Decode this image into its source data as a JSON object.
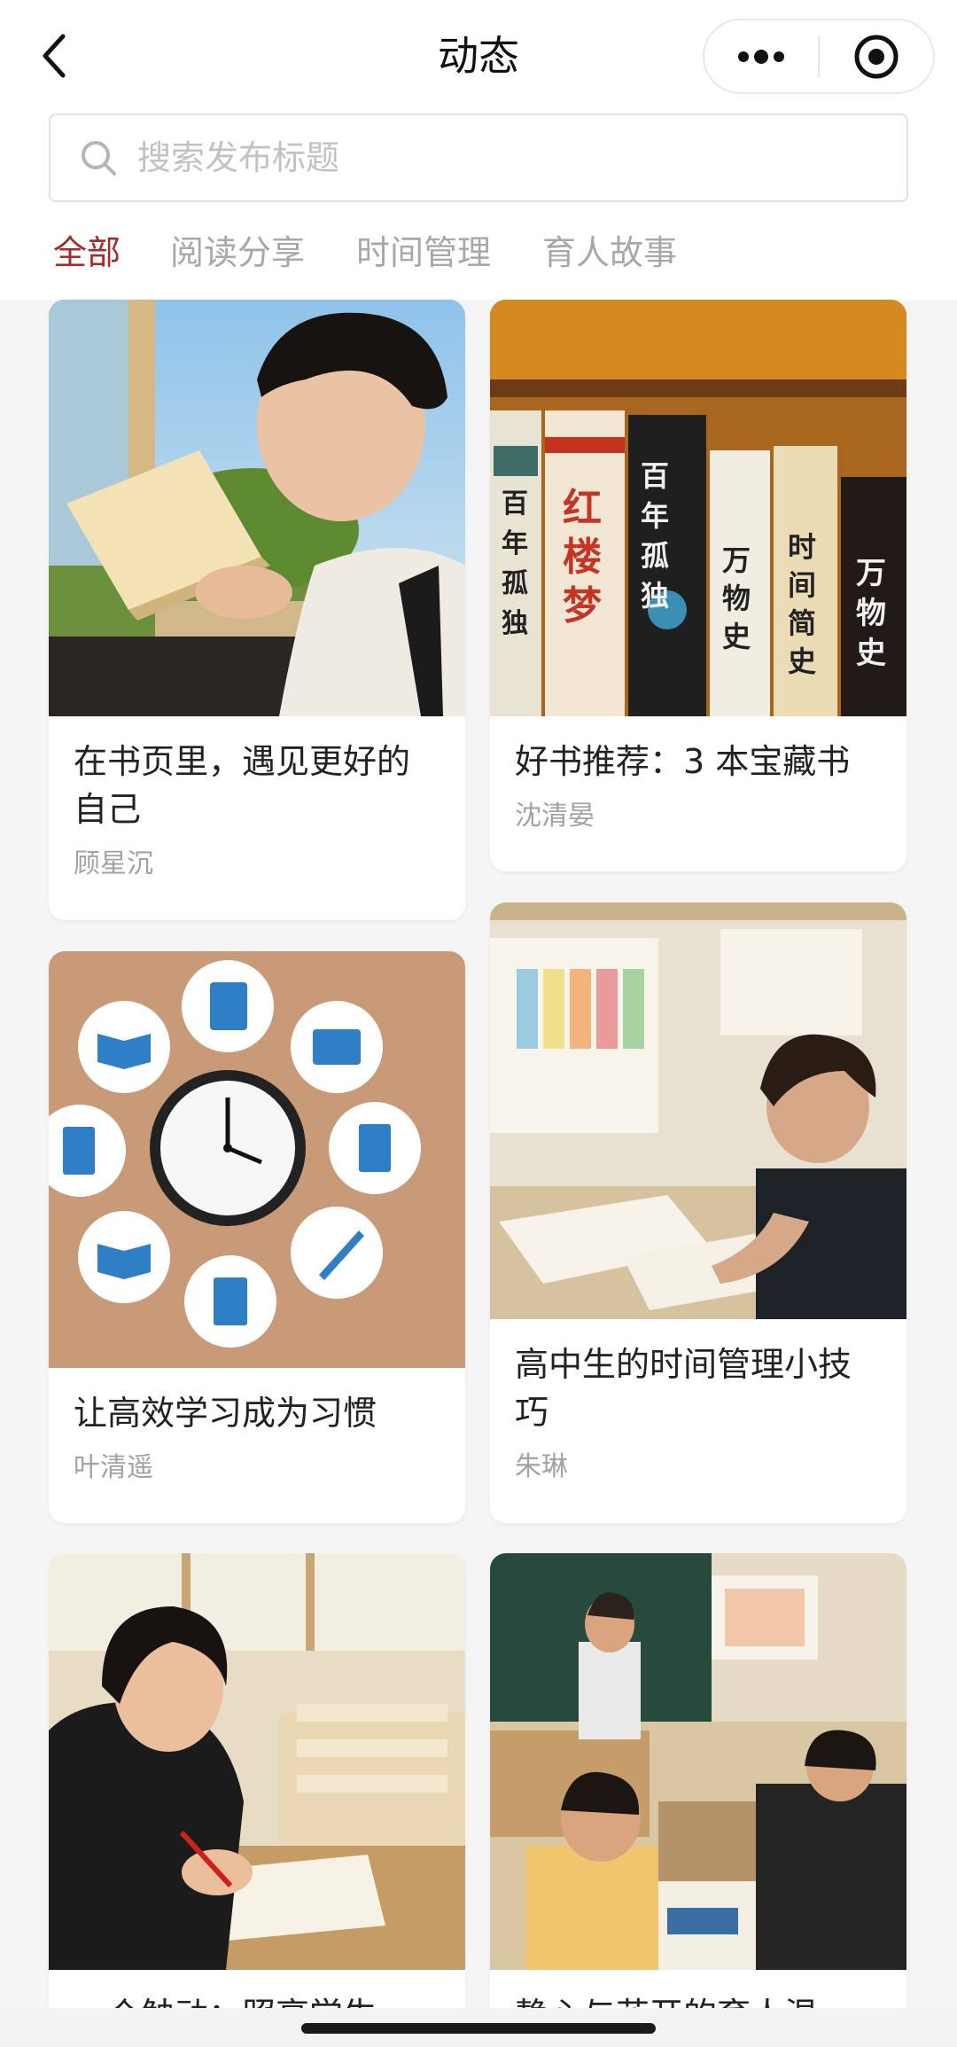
{
  "header": {
    "title": "动态",
    "back_icon": "chevron-left-icon",
    "more_icon": "more-dots-icon",
    "target_icon": "target-icon"
  },
  "search": {
    "placeholder": "搜索发布标题",
    "value": "",
    "icon": "search-icon"
  },
  "tabs": [
    {
      "label": "全部",
      "active": true
    },
    {
      "label": "阅读分享",
      "active": false
    },
    {
      "label": "时间管理",
      "active": false
    },
    {
      "label": "育人故事",
      "active": false
    }
  ],
  "colors": {
    "accent": "#a42a2a",
    "tab_inactive": "#a8a8a8",
    "author": "#a2a2a2"
  },
  "cards": [
    {
      "title": "在书页里，遇见更好的自己",
      "author": "顾星沉",
      "image": "student-reading-photo"
    },
    {
      "title": "好书推荐：3 本宝藏书",
      "author": "沈清晏",
      "image": "bookshelf-photo",
      "book_spines": [
        "百年孤独",
        "红楼梦",
        "百年孤独",
        "万物史",
        "时间简史",
        "万物史"
      ]
    },
    {
      "title": "让高效学习成为习惯",
      "author": "叶清遥",
      "image": "clock-and-study-icons-photo"
    },
    {
      "title": "高中生的时间管理小技巧",
      "author": "朱琳",
      "image": "student-studying-desk-photo"
    },
    {
      "title": "一个触动：照亮学生的…",
      "author": "",
      "image": "teacher-grading-photo"
    },
    {
      "title": "静心与花开的育人温度…",
      "author": "",
      "image": "classroom-photo"
    }
  ]
}
